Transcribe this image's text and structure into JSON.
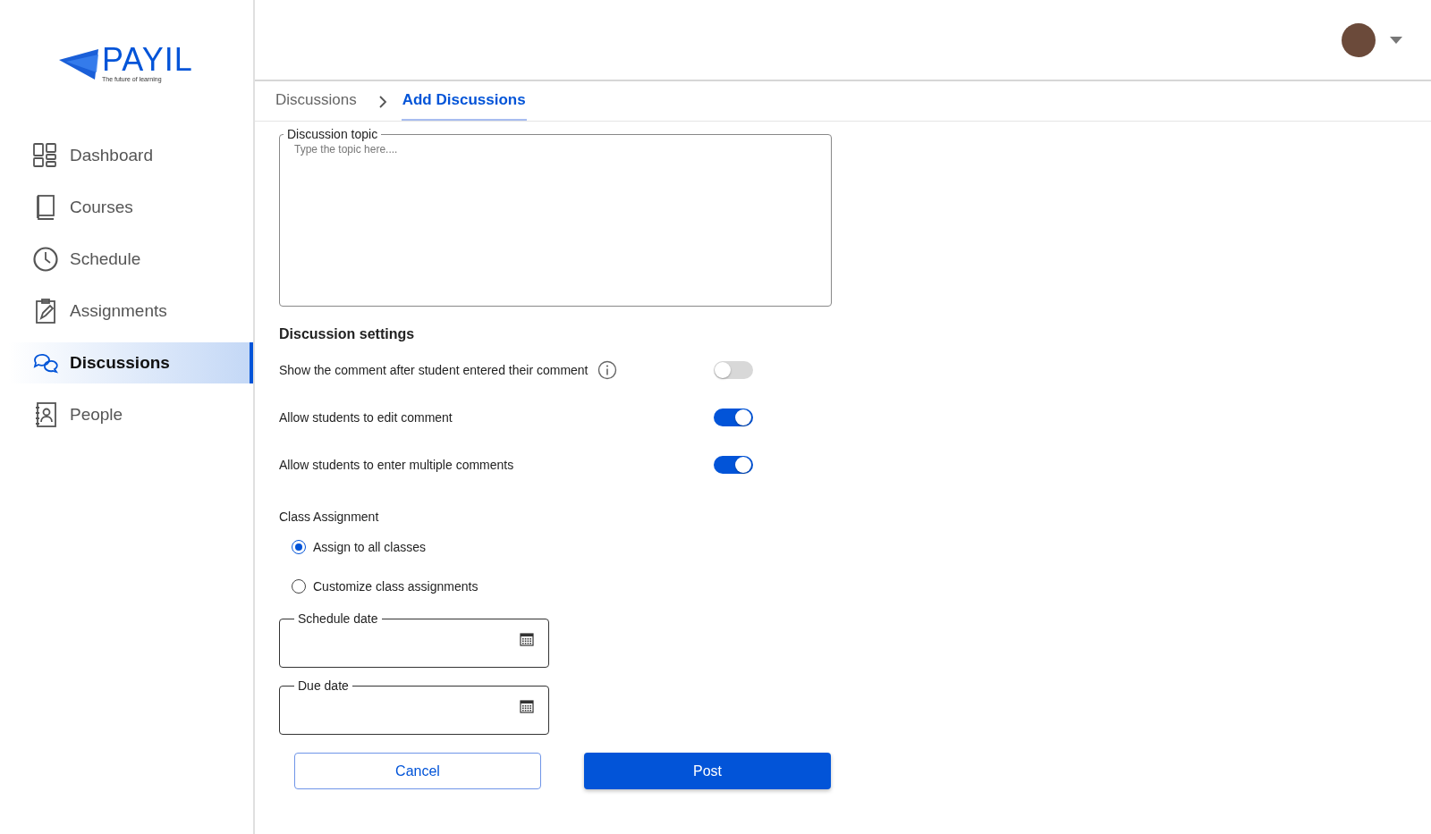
{
  "logo": {
    "name": "PAYIL",
    "tagline": "The future of learning"
  },
  "sidebar": {
    "items": [
      {
        "label": "Dashboard",
        "kind": "dashboard",
        "selected": false
      },
      {
        "label": "Courses",
        "kind": "book",
        "selected": false
      },
      {
        "label": "Schedule",
        "kind": "clock",
        "selected": false
      },
      {
        "label": "Assignments",
        "kind": "clipboard",
        "selected": false
      },
      {
        "label": "Discussions",
        "kind": "chat",
        "selected": true
      },
      {
        "label": "People",
        "kind": "contact",
        "selected": false
      }
    ]
  },
  "breadcrumb": [
    {
      "label": "Discussions",
      "selected": false
    },
    {
      "label": "Add Discussions",
      "selected": true
    }
  ],
  "topic": {
    "label": "Discussion topic",
    "placeholder": "Type the topic here...."
  },
  "settings": {
    "title": "Discussion settings",
    "items": [
      {
        "label": "Show the comment after student entered their comment",
        "info": true,
        "on": false
      },
      {
        "label": "Allow students to edit comment",
        "info": false,
        "on": true
      },
      {
        "label": "Allow students to enter multiple comments",
        "info": false,
        "on": true
      }
    ]
  },
  "class_assignment": {
    "title": "Class Assignment",
    "options": [
      {
        "label": "Assign to all classes",
        "selected": true
      },
      {
        "label": "Customize class assignments",
        "selected": false
      }
    ]
  },
  "dates": [
    {
      "label": "Schedule date"
    },
    {
      "label": "Due date"
    }
  ],
  "buttons": [
    {
      "label": "Cancel",
      "kind": "outline"
    },
    {
      "label": "Post",
      "kind": "primary"
    }
  ]
}
